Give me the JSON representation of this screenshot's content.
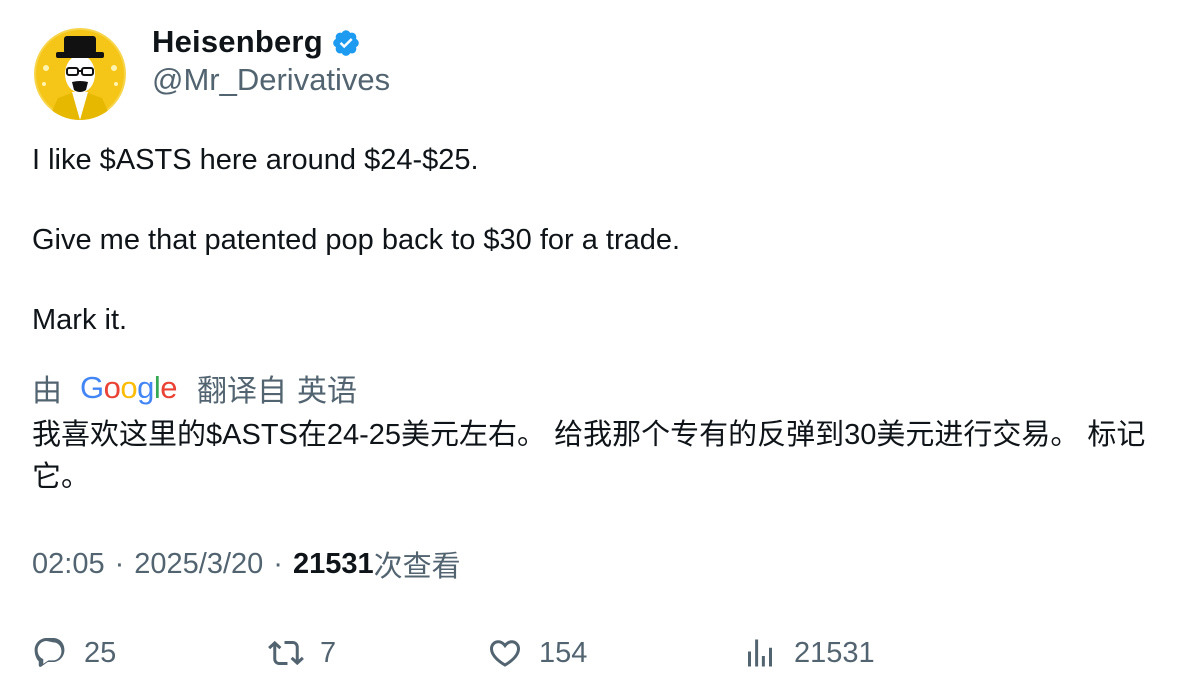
{
  "author": {
    "display_name": "Heisenberg",
    "handle": "@Mr_Derivatives",
    "verified": true
  },
  "tweet": {
    "lines": [
      "I like $ASTS here around $24-$25.",
      "Give me that patented pop back to $30 for a trade.",
      "Mark it."
    ]
  },
  "translation": {
    "by_label": "由",
    "provider": "Google",
    "from_label": "翻译自",
    "language": "英语",
    "text": "我喜欢这里的$ASTS在24-25美元左右。 给我那个专有的反弹到30美元进行交易。 标记它。"
  },
  "meta": {
    "time": "02:05",
    "separator": "·",
    "date": "2025/3/20",
    "views_count": "21531",
    "views_label": "次查看"
  },
  "actions": {
    "reply_count": "25",
    "retweet_count": "7",
    "like_count": "154",
    "views_count": "21531"
  },
  "colors": {
    "text_primary": "#0f1419",
    "text_secondary": "#536471",
    "verified_blue": "#1d9bf0",
    "avatar_yellow": "#f5c518"
  },
  "icons": {
    "verified": "verified-badge-icon",
    "reply": "reply-icon",
    "retweet": "retweet-icon",
    "like": "heart-icon",
    "views": "analytics-icon"
  }
}
